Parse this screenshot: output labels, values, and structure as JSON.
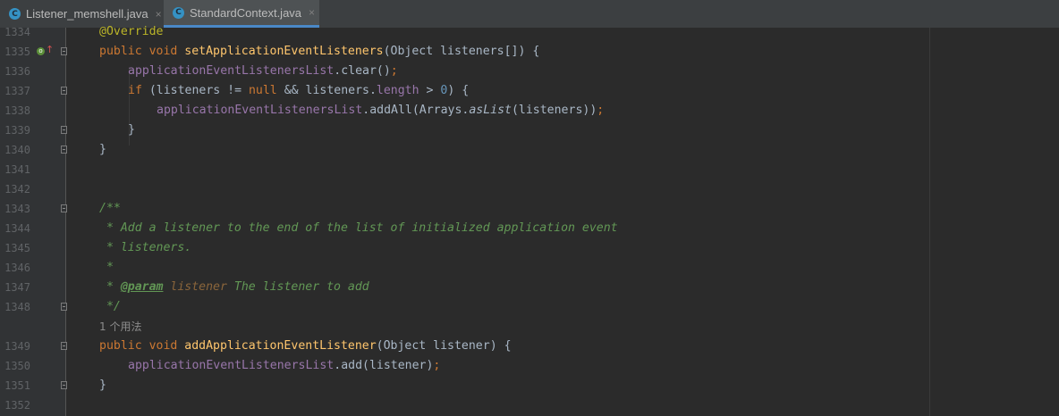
{
  "tabs": [
    {
      "label": "Listener_memshell.java",
      "icon_letter": "C",
      "close": "×"
    },
    {
      "label": "StandardContext.java",
      "icon_letter": "C",
      "close": "×"
    }
  ],
  "gutter": {
    "lines": [
      "1334",
      "1335",
      "1336",
      "1337",
      "1338",
      "1339",
      "1340",
      "1341",
      "1342",
      "1343",
      "1344",
      "1345",
      "1346",
      "1347",
      "1348",
      "1349",
      "1350",
      "1351",
      "1352"
    ],
    "override_marker": "o",
    "override_arrow": "↑"
  },
  "code": {
    "l1334": {
      "annot": "@Override"
    },
    "l1335": {
      "kw": "public void ",
      "method": "setApplicationEventListeners",
      "rest": "(Object listeners[]) {"
    },
    "l1336": {
      "field": "applicationEventListenersList",
      "rest": ".clear()",
      "semi": ";"
    },
    "l1337": {
      "kw": "if ",
      "p1": "(listeners != ",
      "kw2": "null",
      "p2": " && listeners.",
      "field": "length",
      "p3": " > ",
      "num": "0",
      "p4": ") {"
    },
    "l1338": {
      "field": "applicationEventListenersList",
      "p1": ".addAll(Arrays.",
      "italic": "asList",
      "p2": "(listeners))",
      "semi": ";"
    },
    "l1339": {
      "text": "}"
    },
    "l1340": {
      "text": "}"
    },
    "l1343": {
      "text": "/**"
    },
    "l1344": {
      "text": " * Add a listener to the end of the list of initialized application event"
    },
    "l1345": {
      "text": " * listeners."
    },
    "l1346": {
      "text": " *"
    },
    "l1347": {
      "star": " * ",
      "tag": "@param",
      "sp": " ",
      "param": "listener",
      "desc": " The listener to add"
    },
    "l1348": {
      "text": " */"
    },
    "usage": "1 个用法",
    "l1349": {
      "kw": "public void ",
      "method": "addApplicationEventListener",
      "rest": "(Object listener) {"
    },
    "l1350": {
      "field": "applicationEventListenersList",
      "rest": ".add(listener)",
      "semi": ";"
    },
    "l1351": {
      "text": "}"
    }
  }
}
